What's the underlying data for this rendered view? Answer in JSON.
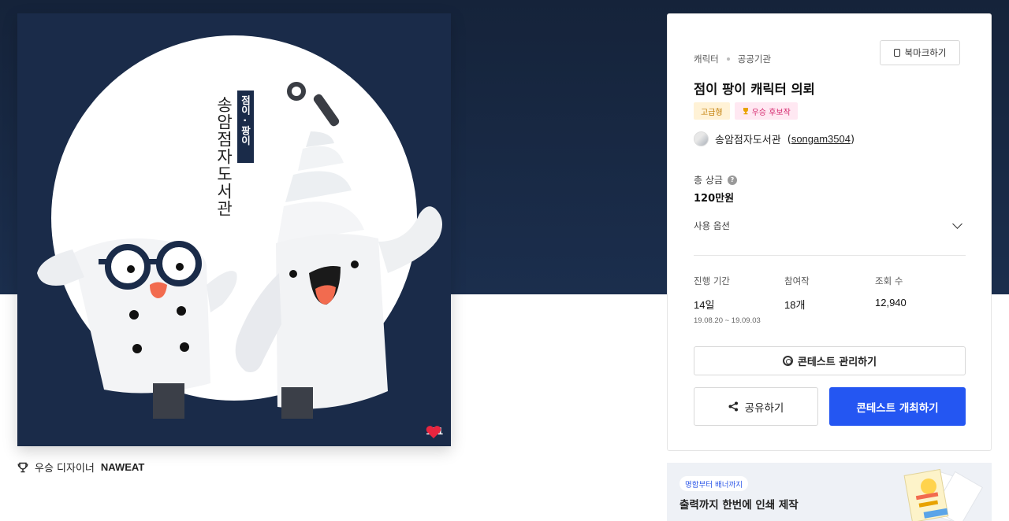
{
  "artwork": {
    "poster_name_vertical": "송암점자도서관",
    "poster_subtitle_vertical": "점이 · 팡이",
    "likes_count": "131"
  },
  "designer": {
    "prefix": "우승 디자이너",
    "name": "NAWEAT"
  },
  "contest": {
    "breadcrumb": [
      "캐릭터",
      "공공기관"
    ],
    "bookmark_label": "북마크하기",
    "title": "점이 팡이 캐릭터 의뢰",
    "tags": {
      "premium": "고급형",
      "award": "우승 후보작"
    },
    "host_name": "송암점자도서관",
    "host_id": "songam3504",
    "prize_label": "총 상금",
    "prize_help": "?",
    "prize_value": "120만원",
    "options_label": "사용 옵션",
    "stats": {
      "period_label": "진행 기간",
      "period_value": "14일",
      "period_dates": "19.08.20 ~ 19.09.03",
      "participants_label": "참여작",
      "participants_value": "18개",
      "views_label": "조회 수",
      "views_value": "12,940"
    },
    "manage_label": "콘테스트 관리하기",
    "share_label": "공유하기",
    "open_label": "콘테스트 개최하기"
  },
  "banner": {
    "pill": "명함부터 배너까지",
    "text": "출력까지 한번에 인쇄 제작"
  },
  "colors": {
    "hero_bg": "#1b2e4d",
    "primary": "#2456f2",
    "heart": "#e8253f"
  }
}
